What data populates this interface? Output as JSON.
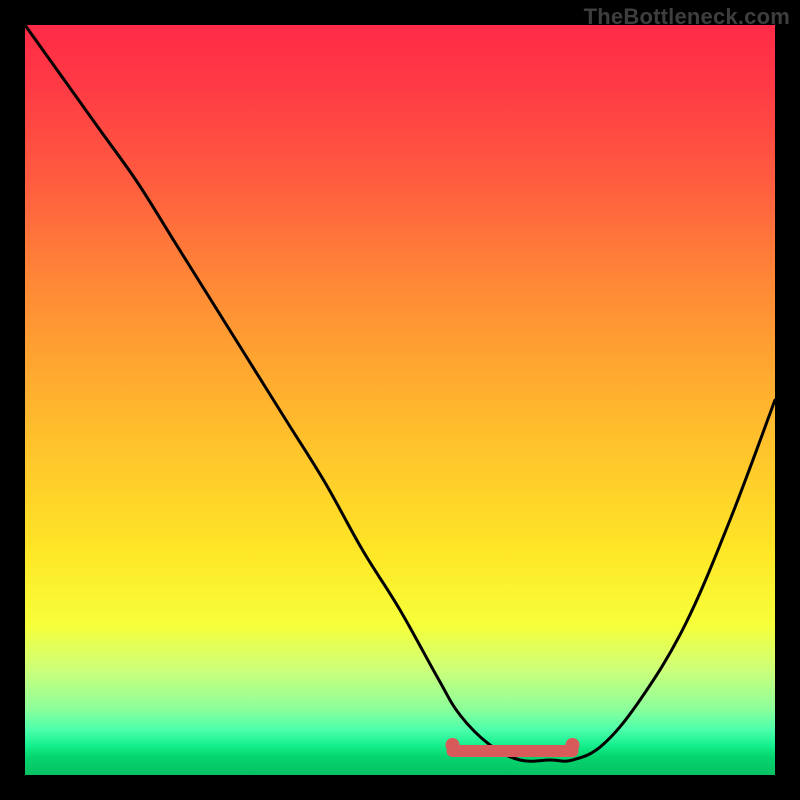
{
  "watermark": "TheBottleneck.com",
  "chart_data": {
    "type": "line",
    "title": "",
    "xlabel": "",
    "ylabel": "",
    "xlim": [
      0,
      100
    ],
    "ylim": [
      0,
      100
    ],
    "series": [
      {
        "name": "bottleneck-curve",
        "x": [
          0,
          5,
          10,
          15,
          20,
          25,
          30,
          35,
          40,
          45,
          50,
          55,
          58,
          62,
          66,
          70,
          73,
          77,
          82,
          88,
          94,
          100
        ],
        "y": [
          100,
          93,
          86,
          79,
          71,
          63,
          55,
          47,
          39,
          30,
          22,
          13,
          8,
          4,
          2,
          2,
          2,
          4,
          10,
          20,
          34,
          50
        ]
      }
    ],
    "markers": [
      {
        "name": "range-start",
        "x": 57,
        "y": 4
      },
      {
        "name": "range-end",
        "x": 73,
        "y": 4
      }
    ],
    "highlight_band": {
      "x0": 57,
      "x1": 73,
      "y": 3.2
    },
    "gradient_stops": [
      {
        "pos": 0,
        "color": "#ff2b47"
      },
      {
        "pos": 0.55,
        "color": "#ffe626"
      },
      {
        "pos": 0.97,
        "color": "#06d66f"
      },
      {
        "pos": 1.0,
        "color": "#06c062"
      }
    ]
  }
}
